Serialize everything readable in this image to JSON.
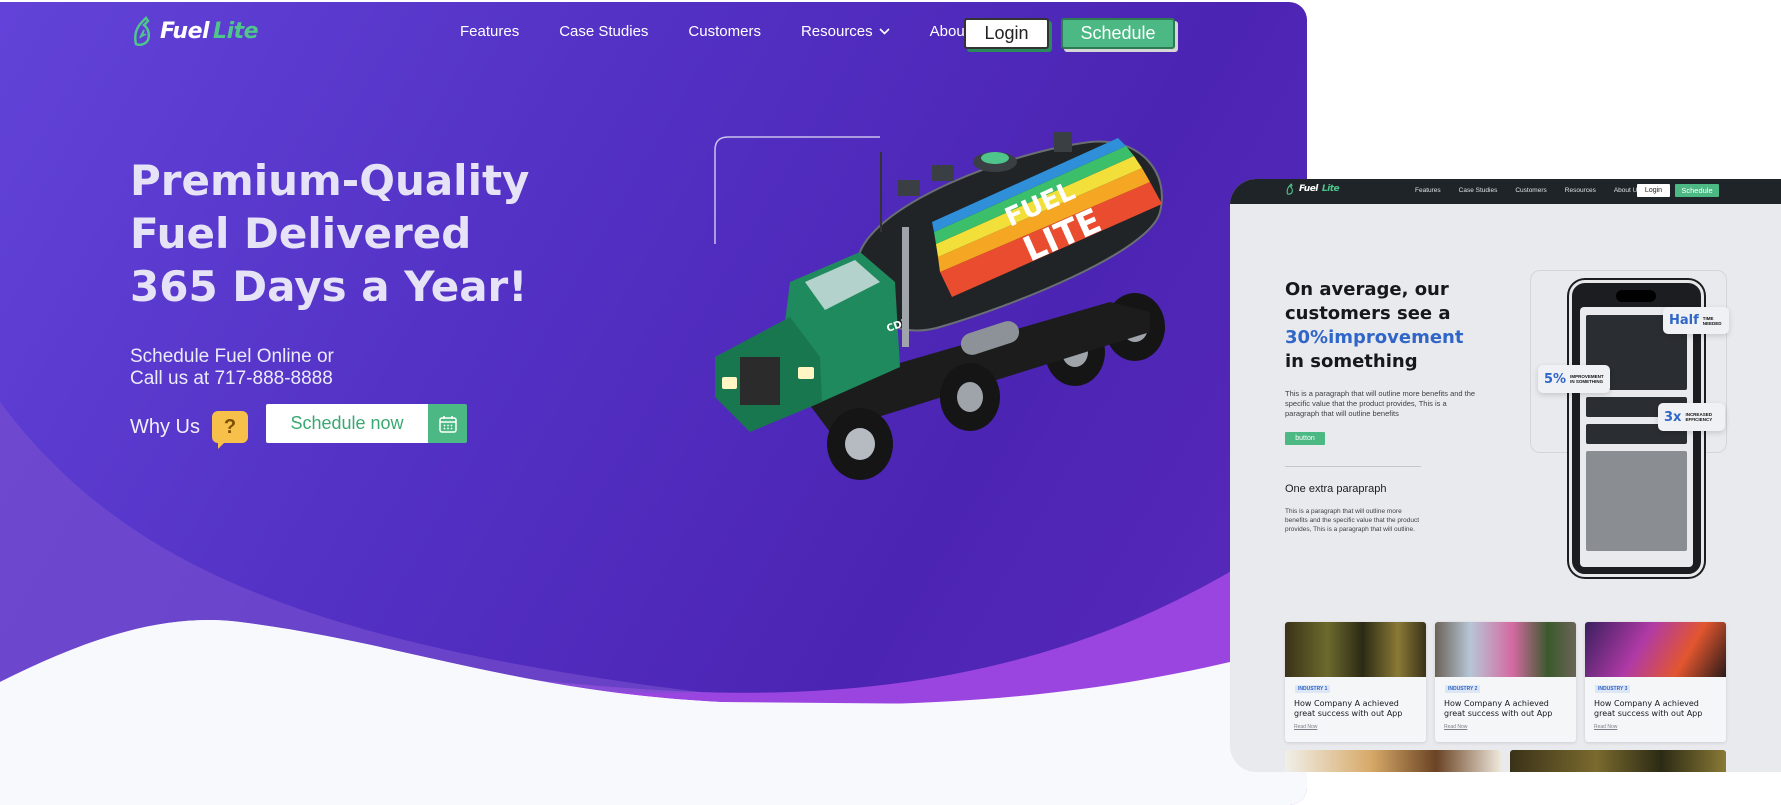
{
  "brand": {
    "word1": "Fuel",
    "word2": "Lite",
    "green": "#4fc58c",
    "purple": "#5432c6"
  },
  "hero": {
    "nav": [
      {
        "label": "Features"
      },
      {
        "label": "Case Studies"
      },
      {
        "label": "Customers"
      },
      {
        "label": "Resources",
        "icon": "chevron-down-icon"
      },
      {
        "label": "About"
      }
    ],
    "login_label": "Login",
    "schedule_label": "Schedule",
    "headline": "Premium-Quality Fuel Delivered 365 Days a Year!",
    "sub_line1": "Schedule Fuel Online or",
    "sub_line2": "Call us at 717-888-8888",
    "why_us": "Why Us",
    "why_icon": "question-mark",
    "schedule_now": "Schedule now",
    "calendar_icon": "calendar-icon",
    "truck": {
      "tank_text_1": "FUEL",
      "tank_text_2": "LITE",
      "door_text": "CDL"
    }
  },
  "secondary": {
    "nav": [
      "Features",
      "Case Studies",
      "Customers",
      "Resources",
      "About Us"
    ],
    "login_label": "Login",
    "schedule_label": "Schedule",
    "heading_pre": "On average, our customers see a ",
    "heading_highlight": "30%improvement",
    "heading_post": " in something",
    "paragraph": "This is a paragraph that will outline more benefits and the specific value that the product provides, This is a paragraph that will outline benefits",
    "button_label": "button",
    "extra_title": "One extra parapraph",
    "extra_paragraph": "This is a paragraph that will outline more benefits and the specific value that the product provides, This is a paragraph that will outline.",
    "stats": [
      {
        "value": "Half",
        "label": "TIME NEEDED"
      },
      {
        "value": "5%",
        "label": "IMPROVEMENT IN SOMETHING"
      },
      {
        "value": "3x",
        "label": "INCREASED EFFICIENCY"
      }
    ],
    "cards": [
      {
        "tag": "INDUSTRY 1",
        "title": "How Company A achieved great success with out App",
        "link": "Read Now"
      },
      {
        "tag": "INDUSTRY 2",
        "title": "How Company A achieved great success with out App",
        "link": "Read Now"
      },
      {
        "tag": "INDUSTRY 3",
        "title": "How Company A achieved great success with out App",
        "link": "Read Now"
      }
    ]
  }
}
